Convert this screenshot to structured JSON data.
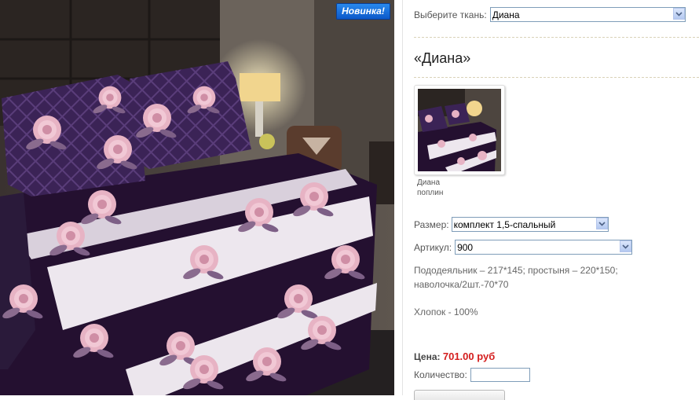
{
  "badge": {
    "label": "Новинка!"
  },
  "fabric": {
    "label": "Выберите ткань:",
    "selected": "Диана"
  },
  "product": {
    "title": "«Диана»",
    "thumb_caption_line1": "Диана",
    "thumb_caption_line2": "поплин"
  },
  "size": {
    "label": "Размер:",
    "selected": "комплект 1,5-спальный"
  },
  "article": {
    "label": "Артикул:",
    "selected": "900"
  },
  "description": {
    "line1": "Пододеяльник – 217*145; простыня – 220*150;",
    "line2": "наволочка/2шт.-70*70",
    "composition": "Хлопок - 100%"
  },
  "price": {
    "label": "Цена:",
    "value": "701.00 руб"
  },
  "quantity": {
    "label": "Количество:",
    "value": ""
  },
  "colors": {
    "accent_price": "#d41e1e",
    "badge": "#1a6fe0",
    "fabric_dark": "#2a1633",
    "rose": "#e9b4c4"
  }
}
